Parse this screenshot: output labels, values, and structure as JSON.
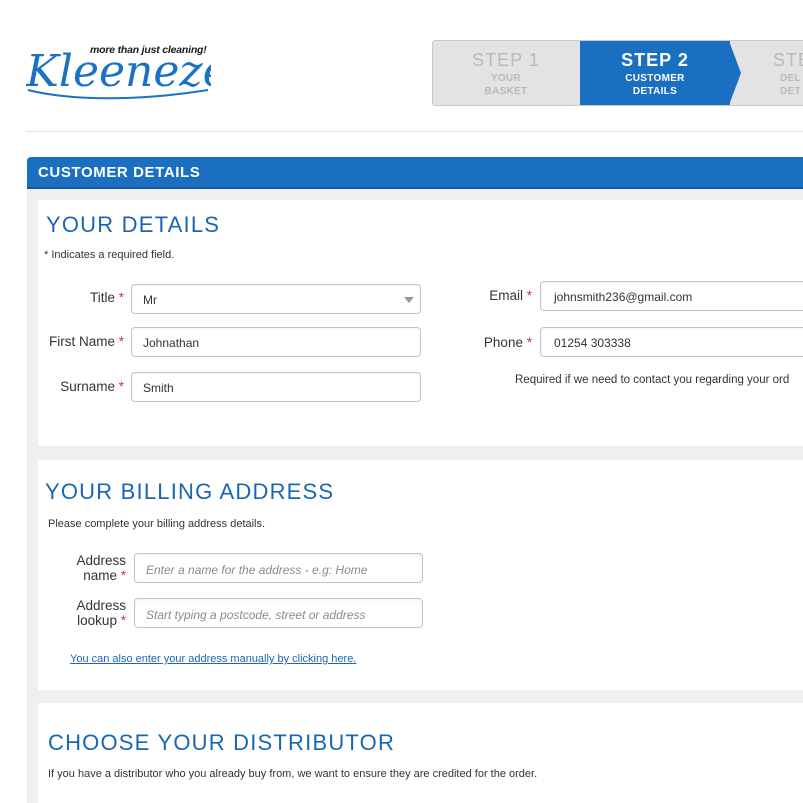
{
  "header": {
    "brand": "Kleeneze",
    "tagline": "more than just cleaning!",
    "steps": [
      {
        "num": "STEP 1",
        "label1": "YOUR",
        "label2": "BASKET"
      },
      {
        "num": "STEP 2",
        "label1": "CUSTOMER",
        "label2": "DETAILS"
      },
      {
        "num": "STE",
        "label1": "DEL",
        "label2": "DET"
      }
    ]
  },
  "section_bar": "CUSTOMER DETAILS",
  "your_details": {
    "heading": "YOUR DETAILS",
    "note": "* Indicates a required field.",
    "title_label": "Title",
    "title_value": "Mr",
    "first_name_label": "First Name",
    "first_name_value": "Johnathan",
    "surname_label": "Surname",
    "surname_value": "Smith",
    "email_label": "Email",
    "email_value": "johnsmith236@gmail.com",
    "phone_label": "Phone",
    "phone_value": "01254 303338",
    "phone_help": "Required if we need to contact you regarding your ord",
    "required_marker": "*"
  },
  "billing": {
    "heading": "YOUR BILLING ADDRESS",
    "note": "Please complete your billing address details.",
    "address_name_label_1": "Address",
    "address_name_label_2": "name",
    "address_name_placeholder": "Enter a name for the address - e.g: Home",
    "address_lookup_label_1": "Address",
    "address_lookup_label_2": "lookup",
    "address_lookup_placeholder": "Start typing a postcode, street or address",
    "manual_link": "You can also enter your address manually by clicking here."
  },
  "distributor": {
    "heading": "CHOOSE YOUR DISTRIBUTOR",
    "note": "If you have a distributor who you already buy from, we want to ensure they are credited for the order."
  },
  "colors": {
    "accent": "#1a6fc0",
    "heading": "#1b66b3",
    "required": "#e02a2a"
  }
}
